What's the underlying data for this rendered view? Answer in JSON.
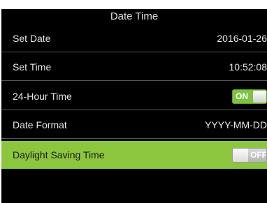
{
  "title": "Date Time",
  "colors": {
    "background": "#000000",
    "selected_row": "#8cc63f",
    "toggle_on": "#7dc242",
    "toggle_off": "#bcbcbc"
  },
  "rows": [
    {
      "label": "Set Date",
      "value": "2016-01-26"
    },
    {
      "label": "Set Time",
      "value": "10:52:08"
    },
    {
      "label": "24-Hour Time",
      "toggle": "ON",
      "state": "on"
    },
    {
      "label": "Date Format",
      "value": "YYYY-MM-DD"
    },
    {
      "label": "Daylight Saving Time",
      "toggle": "OFF",
      "state": "off",
      "selected": true
    }
  ]
}
